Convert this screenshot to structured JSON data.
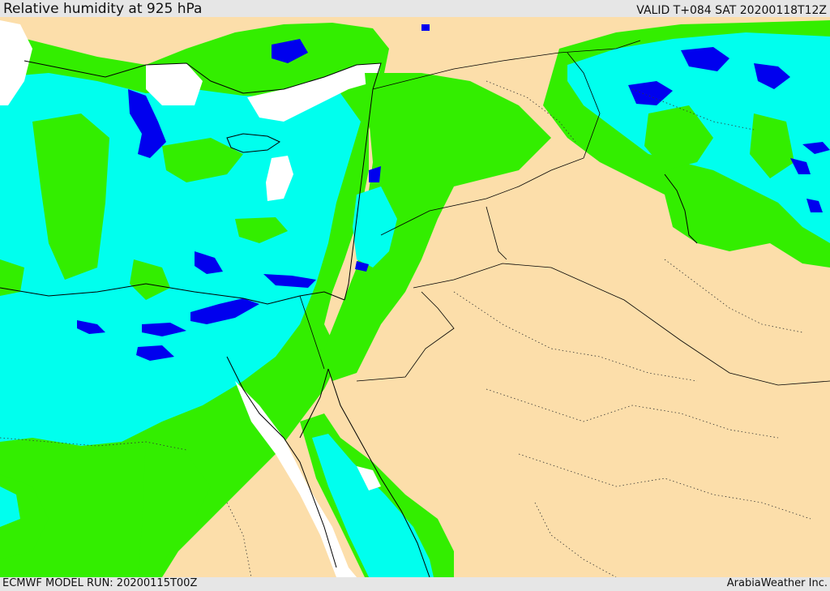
{
  "header": {
    "title": "Relative humidity at 925 hPa",
    "valid_time": "VALID T+084 SAT  20200118T12Z"
  },
  "footer": {
    "model_run": "ECMWF MODEL RUN: 20200115T00Z",
    "credit": "ArabiaWeather Inc."
  },
  "colors": {
    "land_dry": "#fcdeaa",
    "humidity_mid": "#33ee00",
    "humidity_high": "#00ffee",
    "humidity_very_high": "#0000ee",
    "sea_low": "#ffffff",
    "border": "#000000",
    "frame": "#e6e6e6"
  }
}
